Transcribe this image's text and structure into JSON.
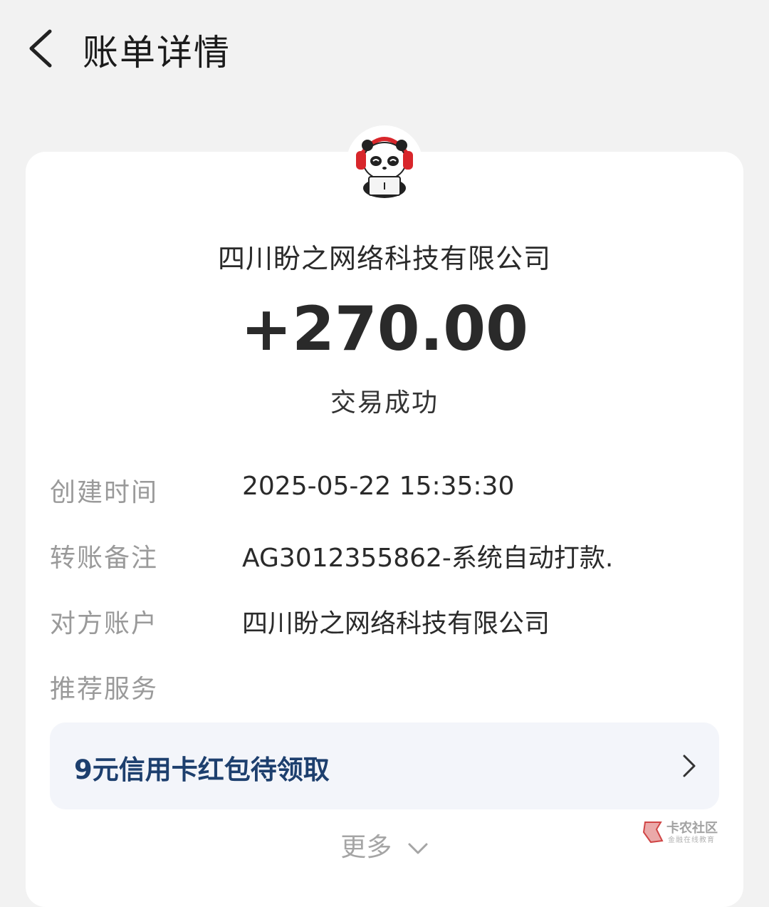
{
  "header": {
    "title": "账单详情"
  },
  "merchant": {
    "name": "四川盼之网络科技有限公司"
  },
  "transaction": {
    "amount": "+270.00",
    "status": "交易成功"
  },
  "details": [
    {
      "label": "创建时间",
      "value": "2025-05-22 15:35:30"
    },
    {
      "label": "转账备注",
      "value": "AG3012355862-系统自动打款."
    },
    {
      "label": "对方账户",
      "value": "四川盼之网络科技有限公司"
    },
    {
      "label": "推荐服务",
      "value": ""
    }
  ],
  "promo": {
    "text": "9元信用卡红包待领取"
  },
  "more": {
    "label": "更多"
  },
  "watermark": {
    "title": "卡农社区",
    "subtitle": "金融在线教育"
  },
  "colors": {
    "background": "#f2f2f2",
    "promo_text": "#1d3f6e",
    "promo_bg": "#f3f5fa",
    "headphones": "#d8262b"
  }
}
